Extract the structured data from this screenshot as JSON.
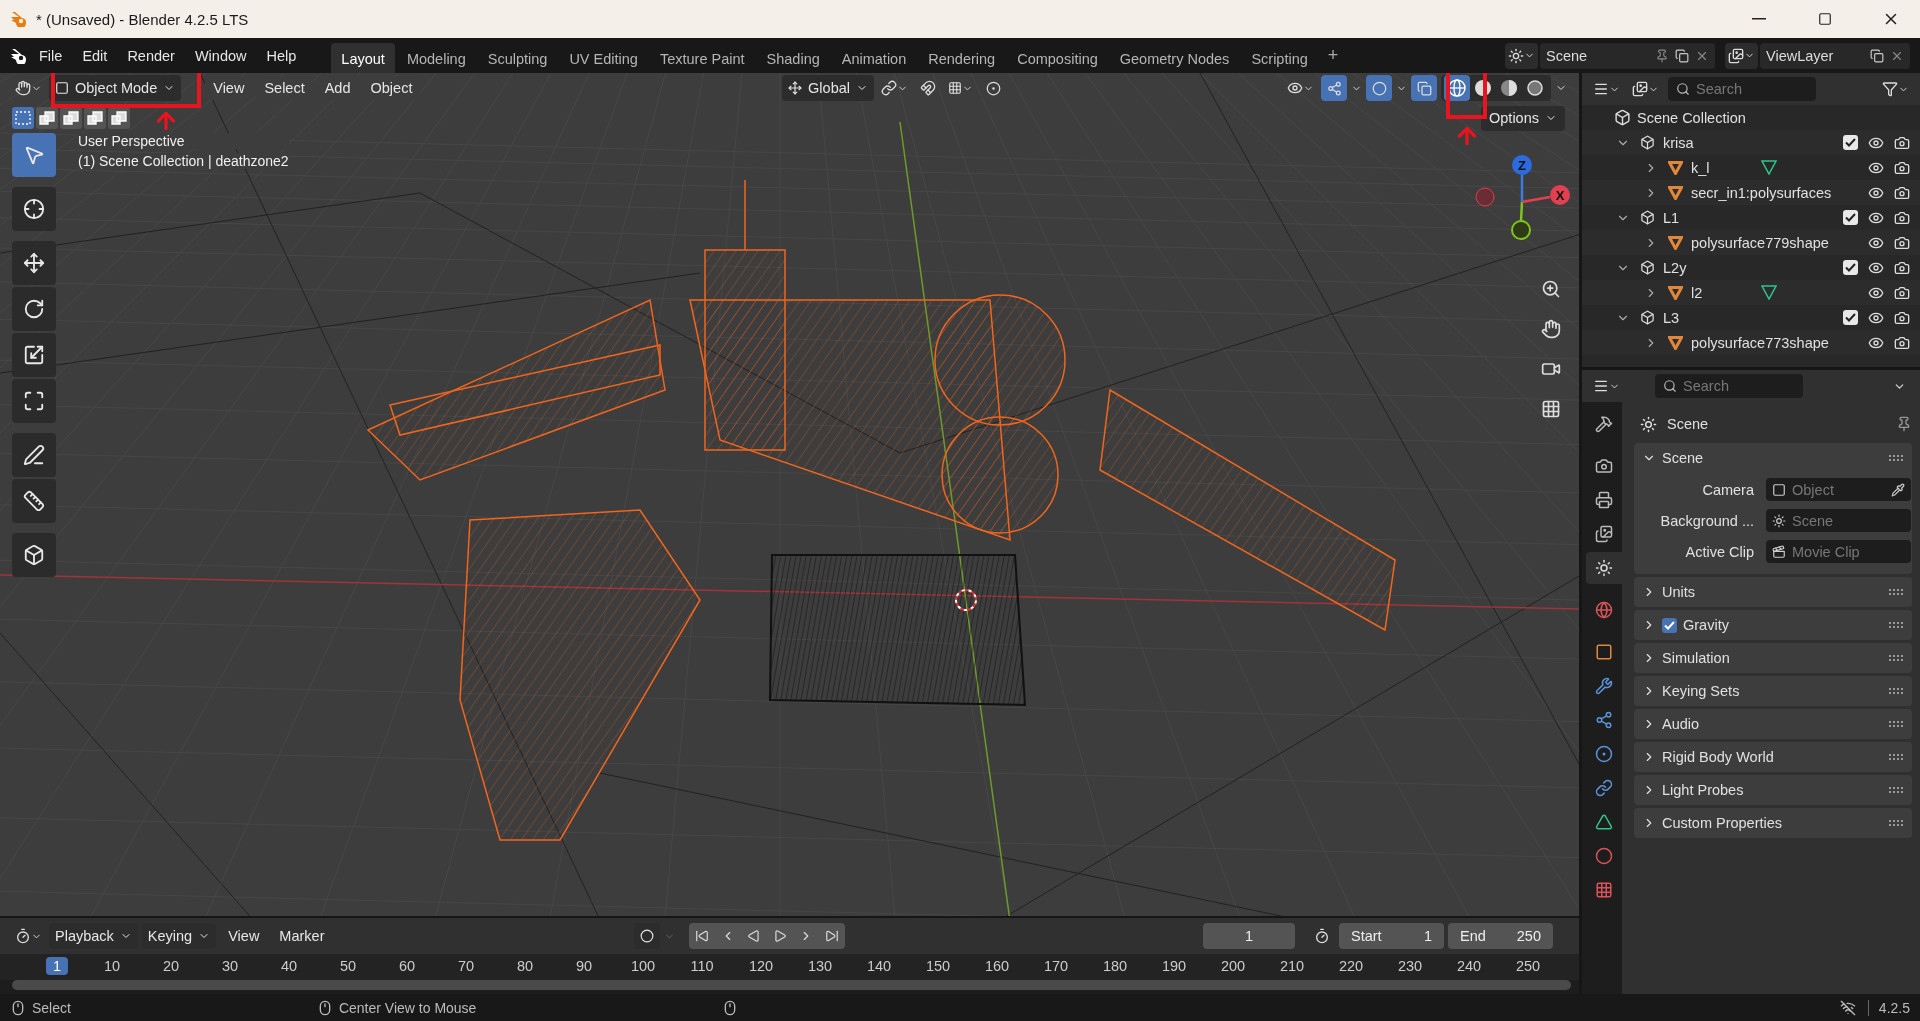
{
  "window": {
    "title": "* (Unsaved) - Blender 4.2.5 LTS"
  },
  "menu": [
    "File",
    "Edit",
    "Render",
    "Window",
    "Help"
  ],
  "workspaces": [
    {
      "label": "Layout",
      "selected": true
    },
    {
      "label": "Modeling",
      "selected": false
    },
    {
      "label": "Sculpting",
      "selected": false
    },
    {
      "label": "UV Editing",
      "selected": false
    },
    {
      "label": "Texture Paint",
      "selected": false
    },
    {
      "label": "Shading",
      "selected": false
    },
    {
      "label": "Animation",
      "selected": false
    },
    {
      "label": "Rendering",
      "selected": false
    },
    {
      "label": "Compositing",
      "selected": false
    },
    {
      "label": "Geometry Nodes",
      "selected": false
    },
    {
      "label": "Scripting",
      "selected": false
    }
  ],
  "add_workspace": "+",
  "scene_field": {
    "value": "Scene"
  },
  "view_layer_field": {
    "value": "ViewLayer"
  },
  "viewport": {
    "mode": "Object Mode",
    "menus": [
      "View",
      "Select",
      "Add",
      "Object"
    ],
    "orientation": "Global",
    "toggles": [
      {
        "kind": "gizmos",
        "on": true
      },
      {
        "kind": "overlays",
        "on": true
      },
      {
        "kind": "xray",
        "on": true
      }
    ],
    "shading": [
      {
        "kind": "wireframe",
        "selected": true
      },
      {
        "kind": "solid",
        "selected": false
      },
      {
        "kind": "material",
        "selected": false
      },
      {
        "kind": "rendered",
        "selected": false
      }
    ],
    "select_modes": [
      {
        "kind": "new",
        "selected": true
      },
      {
        "kind": "extend",
        "selected": false
      },
      {
        "kind": "subtract",
        "selected": false
      },
      {
        "kind": "invert",
        "selected": false
      },
      {
        "kind": "intersect",
        "selected": false
      }
    ],
    "options": "Options",
    "overlay_title": "User Perspective",
    "overlay_info": "(1) Scene Collection | deathzone2",
    "tools": [
      {
        "kind": "select",
        "selected": true
      },
      {
        "kind": "cursor",
        "selected": false
      },
      {
        "kind": "move",
        "selected": false
      },
      {
        "kind": "rotate",
        "selected": false
      },
      {
        "kind": "scale",
        "selected": false
      },
      {
        "kind": "transform",
        "selected": false
      },
      {
        "kind": "annotate",
        "selected": false
      },
      {
        "kind": "measure",
        "selected": false
      },
      {
        "kind": "add_cube",
        "selected": false
      }
    ],
    "gizmo_labels": [
      "Z",
      "X"
    ]
  },
  "outliner": {
    "search_placeholder": "Search",
    "root": "Scene Collection",
    "items": [
      {
        "name": "krisa",
        "kind": "collection",
        "expanded": true,
        "checked": true,
        "children": [
          {
            "name": "k_l",
            "kind": "object",
            "mesh_badge": true
          },
          {
            "name": "secr_in1:polysurfaces",
            "kind": "object",
            "mesh_badge": false
          }
        ]
      },
      {
        "name": "L1",
        "kind": "collection",
        "expanded": true,
        "checked": true,
        "children": [
          {
            "name": "polysurface779shape",
            "kind": "object",
            "mesh_badge": false
          }
        ]
      },
      {
        "name": "L2y",
        "kind": "collection",
        "expanded": true,
        "checked": true,
        "children": [
          {
            "name": "l2",
            "kind": "object",
            "mesh_badge": true
          }
        ]
      },
      {
        "name": "L3",
        "kind": "collection",
        "expanded": true,
        "checked": true,
        "children": [
          {
            "name": "polysurface773shape",
            "kind": "object",
            "mesh_badge": false
          }
        ]
      }
    ]
  },
  "properties": {
    "search_placeholder": "Search",
    "context": "Scene",
    "tabs": [
      {
        "kind": "tool",
        "selected": false
      },
      {
        "kind": "render",
        "selected": false
      },
      {
        "kind": "output",
        "selected": false
      },
      {
        "kind": "view_layer",
        "selected": false
      },
      {
        "kind": "scene",
        "selected": true
      },
      {
        "kind": "world",
        "selected": false
      },
      {
        "kind": "object",
        "selected": false
      },
      {
        "kind": "modifiers",
        "selected": false
      },
      {
        "kind": "particles",
        "selected": false
      },
      {
        "kind": "physics",
        "selected": false
      },
      {
        "kind": "constraints",
        "selected": false
      },
      {
        "kind": "data",
        "selected": false
      },
      {
        "kind": "material",
        "selected": false
      },
      {
        "kind": "texture",
        "selected": false
      }
    ],
    "scene_panel": {
      "title": "Scene",
      "expanded": true,
      "fields": [
        {
          "label": "Camera",
          "placeholder": "Object",
          "kind": "object"
        },
        {
          "label": "Background ...",
          "placeholder": "Scene",
          "kind": "scene"
        },
        {
          "label": "Active Clip",
          "placeholder": "Movie Clip",
          "kind": "clip"
        }
      ]
    },
    "panels": [
      {
        "title": "Units",
        "expanded": false
      },
      {
        "title": "Gravity",
        "expanded": false,
        "checked": true
      },
      {
        "title": "Simulation",
        "expanded": false
      },
      {
        "title": "Keying Sets",
        "expanded": false
      },
      {
        "title": "Audio",
        "expanded": false
      },
      {
        "title": "Rigid Body World",
        "expanded": false
      },
      {
        "title": "Light Probes",
        "expanded": false
      },
      {
        "title": "Custom Properties",
        "expanded": false
      }
    ]
  },
  "timeline": {
    "menus": [
      {
        "label": "Playback",
        "dropdown": true
      },
      {
        "label": "Keying",
        "dropdown": true
      },
      {
        "label": "View",
        "dropdown": false
      },
      {
        "label": "Marker",
        "dropdown": false
      }
    ],
    "auto_keying": false,
    "current_frame": "1",
    "start_label": "Start",
    "start": "1",
    "end_label": "End",
    "end": "250",
    "frames": [
      {
        "label": "1",
        "selected": true
      },
      {
        "label": "10",
        "selected": false
      },
      {
        "label": "20",
        "selected": false
      },
      {
        "label": "30",
        "selected": false
      },
      {
        "label": "40",
        "selected": false
      },
      {
        "label": "50",
        "selected": false
      },
      {
        "label": "60",
        "selected": false
      },
      {
        "label": "70",
        "selected": false
      },
      {
        "label": "80",
        "selected": false
      },
      {
        "label": "90",
        "selected": false
      },
      {
        "label": "100",
        "selected": false
      },
      {
        "label": "110",
        "selected": false
      },
      {
        "label": "120",
        "selected": false
      },
      {
        "label": "130",
        "selected": false
      },
      {
        "label": "140",
        "selected": false
      },
      {
        "label": "150",
        "selected": false
      },
      {
        "label": "160",
        "selected": false
      },
      {
        "label": "170",
        "selected": false
      },
      {
        "label": "180",
        "selected": false
      },
      {
        "label": "190",
        "selected": false
      },
      {
        "label": "200",
        "selected": false
      },
      {
        "label": "210",
        "selected": false
      },
      {
        "label": "220",
        "selected": false
      },
      {
        "label": "230",
        "selected": false
      },
      {
        "label": "240",
        "selected": false
      },
      {
        "label": "250",
        "selected": false
      }
    ]
  },
  "status_bar": {
    "hints": [
      "Select",
      "Center View to Mouse"
    ],
    "version": "4.2.5"
  }
}
